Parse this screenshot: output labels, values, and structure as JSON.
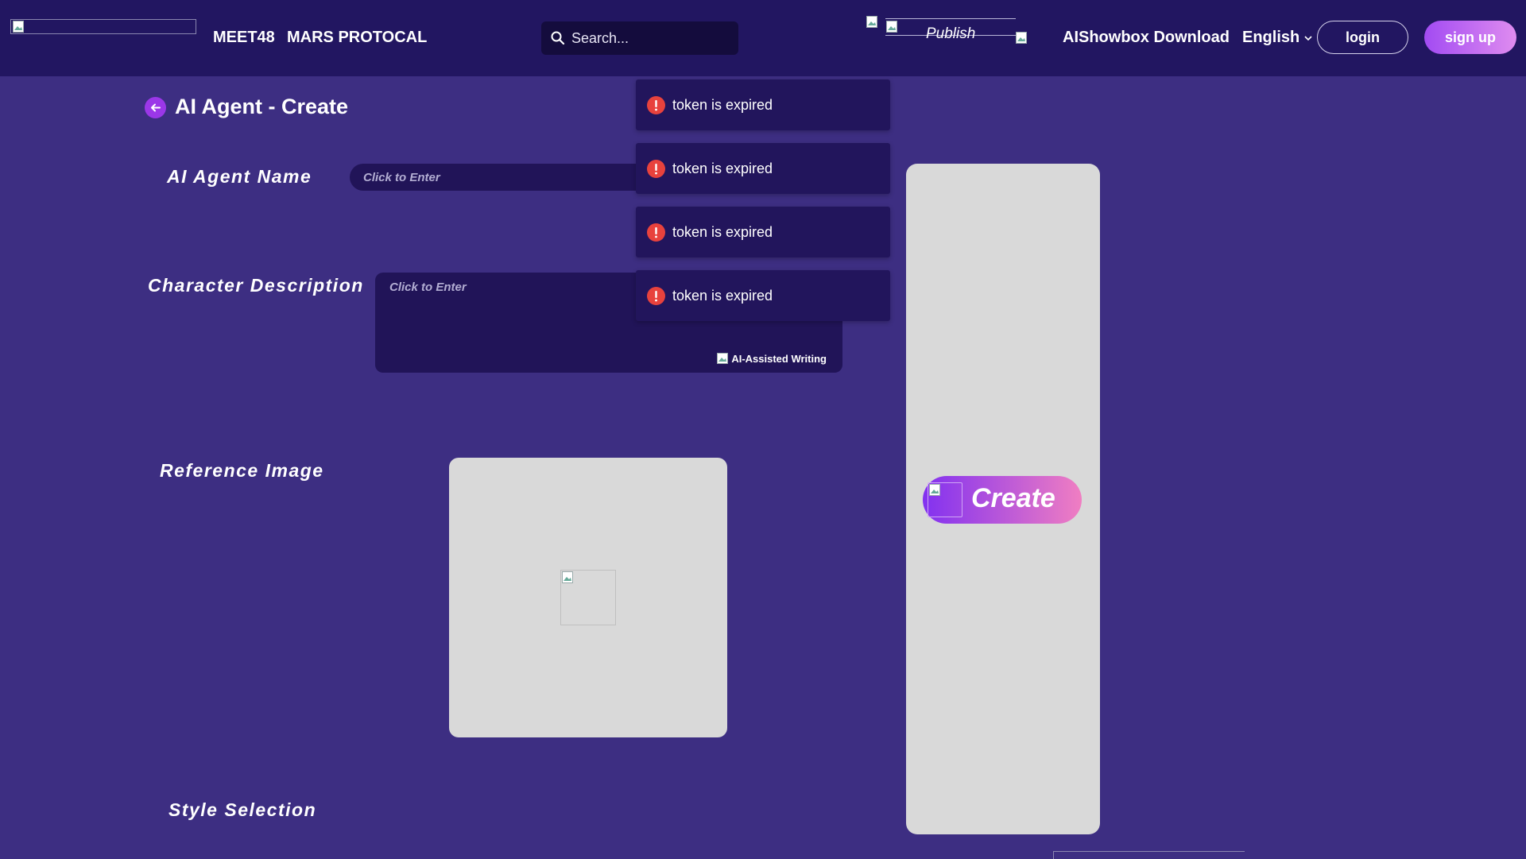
{
  "header": {
    "nav": [
      "MEET48",
      "MARS PROTOCAL"
    ],
    "search_placeholder": "Search...",
    "publish_label": "Publish",
    "download_label": "AIShowbox Download",
    "language": "English",
    "login_label": "login",
    "signup_label": "sign up"
  },
  "page": {
    "title": "AI Agent - Create"
  },
  "form": {
    "name_label": "AI Agent Name",
    "name_placeholder": "Click to Enter",
    "description_label": "Character Description",
    "description_placeholder": "Click to Enter",
    "ai_assist_label": "AI-Assisted Writing",
    "reference_label": "Reference Image",
    "style_label": "Style Selection"
  },
  "toasts": [
    {
      "message": "token is expired"
    },
    {
      "message": "token is expired"
    },
    {
      "message": "token is expired"
    },
    {
      "message": "token is expired"
    }
  ],
  "create_label": "Create",
  "colors": {
    "background": "#3d2e82",
    "topbar": "#221661",
    "input_bg": "#211458",
    "error": "#e8423d",
    "accent_gradient_start": "#8231f0",
    "accent_gradient_end": "#f07ec2"
  },
  "icons": {
    "search": "search-icon",
    "back": "arrow-left-icon",
    "error": "error-icon",
    "language": "chevron-down-icon"
  }
}
